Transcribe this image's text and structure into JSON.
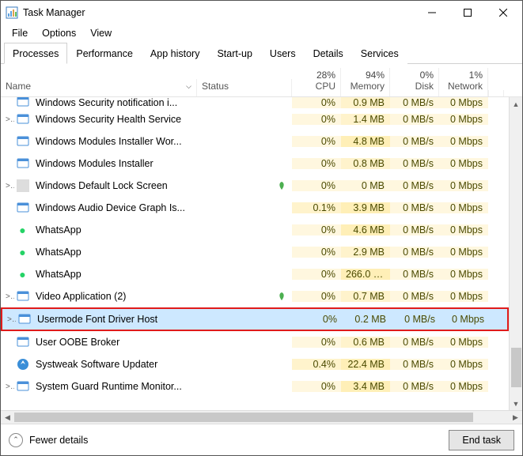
{
  "window": {
    "title": "Task Manager"
  },
  "menu": {
    "file": "File",
    "options": "Options",
    "view": "View"
  },
  "tabs": {
    "processes": "Processes",
    "performance": "Performance",
    "app_history": "App history",
    "startup": "Start-up",
    "users": "Users",
    "details": "Details",
    "services": "Services"
  },
  "columns": {
    "name": "Name",
    "status": "Status",
    "cpu_pct": "28%",
    "cpu": "CPU",
    "mem_pct": "94%",
    "mem": "Memory",
    "disk_pct": "0%",
    "disk": "Disk",
    "net_pct": "1%",
    "net": "Network"
  },
  "rows": [
    {
      "expand": "",
      "icon": "app",
      "name": "Windows Security notification i...",
      "status": "",
      "cpu": "0%",
      "mem": "0.9 MB",
      "disk": "0 MB/s",
      "net": "0 Mbps",
      "mtint": "tint2"
    },
    {
      "expand": ">",
      "icon": "app",
      "name": "Windows Security Health Service",
      "status": "",
      "cpu": "0%",
      "mem": "1.4 MB",
      "disk": "0 MB/s",
      "net": "0 Mbps",
      "mtint": "tint2"
    },
    {
      "expand": "",
      "icon": "app",
      "name": "Windows Modules Installer Wor...",
      "status": "",
      "cpu": "0%",
      "mem": "4.8 MB",
      "disk": "0 MB/s",
      "net": "0 Mbps",
      "mtint": "tint1"
    },
    {
      "expand": "",
      "icon": "app",
      "name": "Windows Modules Installer",
      "status": "",
      "cpu": "0%",
      "mem": "0.8 MB",
      "disk": "0 MB/s",
      "net": "0 Mbps",
      "mtint": "tint2"
    },
    {
      "expand": ">",
      "icon": "blank",
      "name": "Windows Default Lock Screen",
      "status": "leaf",
      "cpu": "0%",
      "mem": "0 MB",
      "disk": "0 MB/s",
      "net": "0 Mbps",
      "mtint": "tint0"
    },
    {
      "expand": "",
      "icon": "app",
      "name": "Windows Audio Device Graph Is...",
      "status": "",
      "cpu": "0.1%",
      "mem": "3.9 MB",
      "disk": "0 MB/s",
      "net": "0 Mbps",
      "ctint": "tint2",
      "mtint": "tint1"
    },
    {
      "expand": "",
      "icon": "wa",
      "name": "WhatsApp",
      "status": "",
      "cpu": "0%",
      "mem": "4.6 MB",
      "disk": "0 MB/s",
      "net": "0 Mbps",
      "mtint": "tint1"
    },
    {
      "expand": "",
      "icon": "wa",
      "name": "WhatsApp",
      "status": "",
      "cpu": "0%",
      "mem": "2.9 MB",
      "disk": "0 MB/s",
      "net": "0 Mbps",
      "mtint": "tint2"
    },
    {
      "expand": "",
      "icon": "wa",
      "name": "WhatsApp",
      "status": "",
      "cpu": "0%",
      "mem": "266.0 MB",
      "disk": "0 MB/s",
      "net": "0 Mbps",
      "mtint": "tint1"
    },
    {
      "expand": ">",
      "icon": "app",
      "name": "Video Application (2)",
      "status": "leaf",
      "cpu": "0%",
      "mem": "0.7 MB",
      "disk": "0 MB/s",
      "net": "0 Mbps",
      "mtint": "tint2"
    },
    {
      "expand": ">",
      "icon": "app",
      "name": "Usermode Font Driver Host",
      "status": "",
      "cpu": "0%",
      "mem": "0.2 MB",
      "disk": "0 MB/s",
      "net": "0 Mbps",
      "sel": true
    },
    {
      "expand": "",
      "icon": "app",
      "name": "User OOBE Broker",
      "status": "",
      "cpu": "0%",
      "mem": "0.6 MB",
      "disk": "0 MB/s",
      "net": "0 Mbps",
      "mtint": "tint2"
    },
    {
      "expand": "",
      "icon": "sys",
      "name": "Systweak Software Updater",
      "status": "",
      "cpu": "0.4%",
      "mem": "22.4 MB",
      "disk": "0 MB/s",
      "net": "0 Mbps",
      "ctint": "tint2",
      "mtint": "tint1"
    },
    {
      "expand": ">",
      "icon": "app",
      "name": "System Guard Runtime Monitor...",
      "status": "",
      "cpu": "0%",
      "mem": "3.4 MB",
      "disk": "0 MB/s",
      "net": "0 Mbps",
      "mtint": "tint1"
    }
  ],
  "footer": {
    "fewer": "Fewer details",
    "end": "End task"
  }
}
